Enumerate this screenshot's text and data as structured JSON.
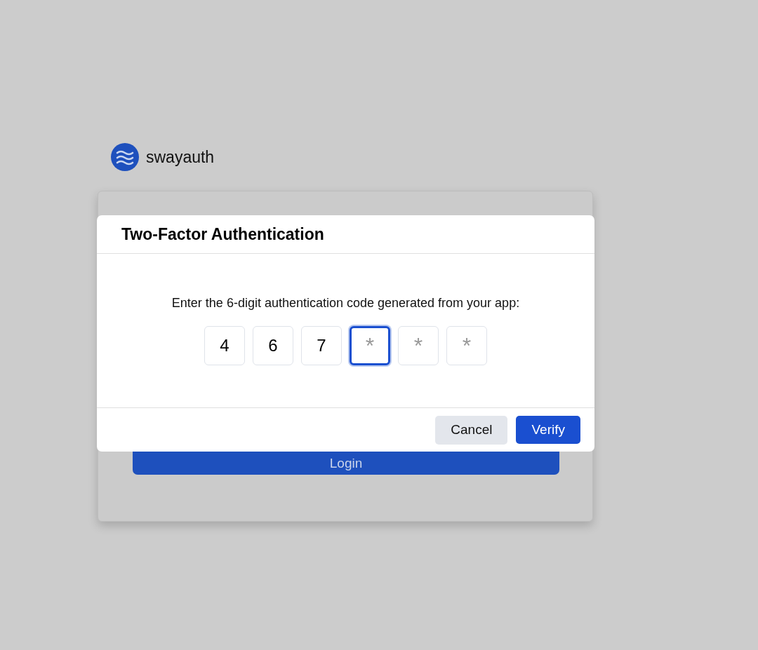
{
  "brand": {
    "name": "swayauth"
  },
  "login_button": {
    "label": "Login"
  },
  "dialog": {
    "title": "Two-Factor Authentication",
    "prompt": "Enter the 6-digit authentication code generated from your app:",
    "digits": [
      {
        "value": "4",
        "selected": false
      },
      {
        "value": "6",
        "selected": false
      },
      {
        "value": "7",
        "selected": false
      },
      {
        "placeholder": "*",
        "selected": true
      },
      {
        "placeholder": "*",
        "selected": false
      },
      {
        "placeholder": "*",
        "selected": false
      }
    ],
    "buttons": [
      {
        "label": "Cancel",
        "kind": "secondary"
      },
      {
        "label": "Verify",
        "kind": "primary"
      }
    ]
  }
}
